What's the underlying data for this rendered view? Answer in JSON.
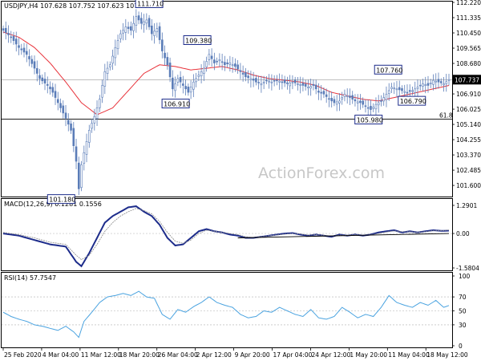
{
  "chart_data": [
    {
      "panel": "price",
      "type": "candlestick",
      "header": "USDJPY,H4  107.628 107.752 107.623 107.737",
      "ylim": [
        101.0,
        112.22
      ],
      "y_ticks": [
        "112.220",
        "111.335",
        "110.450",
        "109.565",
        "108.680",
        "107.795",
        "106.910",
        "106.025",
        "105.140",
        "104.255",
        "103.370",
        "102.485",
        "101.600"
      ],
      "current_price": "107.737",
      "level_61_8": {
        "label": "61.8",
        "value": 105.45
      },
      "horizontal_line": 107.737,
      "annotations": [
        {
          "text": "111.710",
          "x": "Mar 20",
          "value": 111.71
        },
        {
          "text": "109.380",
          "x": "Mar 30",
          "value": 109.38
        },
        {
          "text": "106.910",
          "x": "Mar 26",
          "value": 106.91
        },
        {
          "text": "107.760",
          "x": "May 5",
          "value": 107.76
        },
        {
          "text": "106.790",
          "x": "May 7",
          "value": 106.79
        },
        {
          "text": "105.980",
          "x": "May 6",
          "value": 105.98
        },
        {
          "text": "101.180",
          "x": "Mar 9",
          "value": 101.18
        }
      ],
      "close_series": [
        [
          0,
          110.6
        ],
        [
          3,
          110.2
        ],
        [
          6,
          109.6
        ],
        [
          9,
          109.2
        ],
        [
          12,
          108.4
        ],
        [
          14,
          107.8
        ],
        [
          17,
          107.4
        ],
        [
          19,
          107.0
        ],
        [
          21,
          106.4
        ],
        [
          24,
          105.5
        ],
        [
          26,
          104.8
        ],
        [
          28,
          103.0
        ],
        [
          29,
          101.4
        ],
        [
          30,
          102.8
        ],
        [
          31,
          103.5
        ],
        [
          33,
          104.8
        ],
        [
          35,
          105.6
        ],
        [
          37,
          106.6
        ],
        [
          39,
          108.2
        ],
        [
          41,
          108.6
        ],
        [
          43,
          109.6
        ],
        [
          45,
          110.4
        ],
        [
          47,
          110.8
        ],
        [
          49,
          110.6
        ],
        [
          51,
          111.4
        ],
        [
          53,
          111.0
        ],
        [
          55,
          111.2
        ],
        [
          57,
          110.4
        ],
        [
          59,
          110.7
        ],
        [
          61,
          109.4
        ],
        [
          63,
          108.6
        ],
        [
          65,
          107.2
        ],
        [
          67,
          107.8
        ],
        [
          69,
          107.4
        ],
        [
          71,
          107.0
        ],
        [
          73,
          107.6
        ],
        [
          75,
          108.0
        ],
        [
          77,
          108.4
        ],
        [
          79,
          109.2
        ],
        [
          81,
          108.7
        ],
        [
          83,
          108.9
        ],
        [
          85,
          108.6
        ],
        [
          87,
          108.7
        ],
        [
          89,
          108.5
        ],
        [
          91,
          108.2
        ],
        [
          93,
          107.9
        ],
        [
          95,
          107.8
        ],
        [
          97,
          107.6
        ],
        [
          99,
          107.5
        ],
        [
          101,
          107.7
        ],
        [
          103,
          107.6
        ],
        [
          105,
          107.7
        ],
        [
          107,
          107.6
        ],
        [
          109,
          107.5
        ],
        [
          111,
          107.6
        ],
        [
          113,
          107.5
        ],
        [
          115,
          107.4
        ],
        [
          117,
          107.3
        ],
        [
          119,
          107.4
        ],
        [
          121,
          107.0
        ],
        [
          123,
          106.9
        ],
        [
          125,
          106.6
        ],
        [
          127,
          106.4
        ],
        [
          129,
          106.5
        ],
        [
          131,
          106.9
        ],
        [
          133,
          106.7
        ],
        [
          135,
          106.5
        ],
        [
          137,
          106.4
        ],
        [
          139,
          106.2
        ],
        [
          141,
          106.0
        ],
        [
          143,
          106.3
        ],
        [
          145,
          106.5
        ],
        [
          147,
          106.9
        ],
        [
          149,
          107.3
        ],
        [
          151,
          107.2
        ],
        [
          153,
          107.1
        ],
        [
          155,
          107.0
        ],
        [
          157,
          107.1
        ],
        [
          159,
          107.3
        ],
        [
          161,
          107.5
        ],
        [
          163,
          107.4
        ],
        [
          165,
          107.7
        ],
        [
          167,
          107.6
        ],
        [
          169,
          107.5
        ],
        [
          171,
          107.74
        ]
      ],
      "ma_series": [
        [
          0,
          110.5
        ],
        [
          6,
          110.2
        ],
        [
          12,
          109.6
        ],
        [
          18,
          108.7
        ],
        [
          24,
          107.6
        ],
        [
          30,
          106.4
        ],
        [
          36,
          105.7
        ],
        [
          42,
          106.1
        ],
        [
          48,
          107.1
        ],
        [
          54,
          108.1
        ],
        [
          60,
          108.6
        ],
        [
          66,
          108.5
        ],
        [
          72,
          108.3
        ],
        [
          78,
          108.4
        ],
        [
          84,
          108.5
        ],
        [
          90,
          108.3
        ],
        [
          96,
          108.0
        ],
        [
          102,
          107.8
        ],
        [
          108,
          107.7
        ],
        [
          114,
          107.6
        ],
        [
          120,
          107.4
        ],
        [
          126,
          107.0
        ],
        [
          132,
          106.8
        ],
        [
          138,
          106.6
        ],
        [
          144,
          106.5
        ],
        [
          150,
          106.7
        ],
        [
          156,
          106.9
        ],
        [
          162,
          107.1
        ],
        [
          168,
          107.3
        ],
        [
          171,
          107.4
        ]
      ]
    },
    {
      "panel": "macd",
      "type": "line",
      "header": "MACD(12,26,9) 0.1281 0.1556",
      "ylim": [
        -1.5804,
        1.2901
      ],
      "y_ticks": [
        "1.2901",
        "0.00",
        "-1.5804"
      ],
      "series": [
        {
          "name": "MACD",
          "values": [
            [
              0,
              0.0
            ],
            [
              6,
              -0.1
            ],
            [
              12,
              -0.3
            ],
            [
              18,
              -0.5
            ],
            [
              24,
              -0.6
            ],
            [
              28,
              -1.3
            ],
            [
              30,
              -1.5
            ],
            [
              33,
              -0.9
            ],
            [
              36,
              -0.2
            ],
            [
              39,
              0.5
            ],
            [
              42,
              0.8
            ],
            [
              45,
              1.0
            ],
            [
              48,
              1.2
            ],
            [
              51,
              1.25
            ],
            [
              54,
              1.0
            ],
            [
              57,
              0.8
            ],
            [
              60,
              0.4
            ],
            [
              63,
              -0.2
            ],
            [
              66,
              -0.55
            ],
            [
              69,
              -0.5
            ],
            [
              72,
              -0.2
            ],
            [
              75,
              0.1
            ],
            [
              78,
              0.2
            ],
            [
              81,
              0.1
            ],
            [
              84,
              0.05
            ],
            [
              87,
              -0.05
            ],
            [
              90,
              -0.1
            ],
            [
              93,
              -0.2
            ],
            [
              96,
              -0.2
            ],
            [
              99,
              -0.15
            ],
            [
              102,
              -0.1
            ],
            [
              105,
              -0.05
            ],
            [
              108,
              0.0
            ],
            [
              111,
              0.02
            ],
            [
              114,
              -0.05
            ],
            [
              117,
              -0.1
            ],
            [
              120,
              -0.05
            ],
            [
              123,
              -0.1
            ],
            [
              126,
              -0.15
            ],
            [
              129,
              -0.05
            ],
            [
              132,
              -0.1
            ],
            [
              135,
              -0.05
            ],
            [
              138,
              -0.1
            ],
            [
              141,
              -0.05
            ],
            [
              144,
              0.05
            ],
            [
              147,
              0.1
            ],
            [
              150,
              0.15
            ],
            [
              153,
              0.05
            ],
            [
              156,
              0.1
            ],
            [
              159,
              0.05
            ],
            [
              162,
              0.1
            ],
            [
              165,
              0.15
            ],
            [
              168,
              0.12
            ],
            [
              171,
              0.13
            ]
          ]
        },
        {
          "name": "Signal",
          "values": [
            [
              0,
              0.05
            ],
            [
              6,
              -0.05
            ],
            [
              12,
              -0.2
            ],
            [
              18,
              -0.4
            ],
            [
              24,
              -0.5
            ],
            [
              28,
              -1.0
            ],
            [
              30,
              -1.2
            ],
            [
              33,
              -1.0
            ],
            [
              36,
              -0.5
            ],
            [
              39,
              0.1
            ],
            [
              42,
              0.5
            ],
            [
              45,
              0.8
            ],
            [
              48,
              1.0
            ],
            [
              51,
              1.15
            ],
            [
              54,
              1.05
            ],
            [
              57,
              0.9
            ],
            [
              60,
              0.55
            ],
            [
              63,
              0.05
            ],
            [
              66,
              -0.35
            ],
            [
              69,
              -0.45
            ],
            [
              72,
              -0.3
            ],
            [
              75,
              0.0
            ],
            [
              78,
              0.15
            ],
            [
              81,
              0.1
            ],
            [
              84,
              0.05
            ],
            [
              87,
              0.0
            ],
            [
              90,
              -0.05
            ],
            [
              93,
              -0.15
            ],
            [
              96,
              -0.18
            ],
            [
              99,
              -0.15
            ],
            [
              102,
              -0.1
            ],
            [
              105,
              -0.07
            ],
            [
              108,
              -0.03
            ],
            [
              111,
              0.0
            ],
            [
              114,
              -0.02
            ],
            [
              117,
              -0.07
            ],
            [
              120,
              -0.06
            ],
            [
              123,
              -0.08
            ],
            [
              126,
              -0.12
            ],
            [
              129,
              -0.08
            ],
            [
              132,
              -0.08
            ],
            [
              135,
              -0.06
            ],
            [
              138,
              -0.08
            ],
            [
              141,
              -0.06
            ],
            [
              144,
              0.0
            ],
            [
              147,
              0.07
            ],
            [
              150,
              0.12
            ],
            [
              153,
              0.08
            ],
            [
              156,
              0.08
            ],
            [
              159,
              0.06
            ],
            [
              162,
              0.08
            ],
            [
              165,
              0.13
            ],
            [
              168,
              0.13
            ],
            [
              171,
              0.16
            ]
          ]
        },
        {
          "name": "Trendline",
          "values": [
            [
              90,
              -0.2
            ],
            [
              171,
              0.0
            ]
          ]
        }
      ]
    },
    {
      "panel": "rsi",
      "type": "line",
      "header": "RSI(14) 57.7547",
      "ylim": [
        0,
        100
      ],
      "y_ticks": [
        "100",
        "70",
        "50",
        "30",
        "0"
      ],
      "series": [
        {
          "name": "RSI",
          "values": [
            [
              0,
              48
            ],
            [
              3,
              42
            ],
            [
              6,
              38
            ],
            [
              9,
              35
            ],
            [
              12,
              30
            ],
            [
              15,
              28
            ],
            [
              18,
              25
            ],
            [
              21,
              22
            ],
            [
              24,
              28
            ],
            [
              27,
              20
            ],
            [
              29,
              12
            ],
            [
              31,
              35
            ],
            [
              34,
              48
            ],
            [
              37,
              62
            ],
            [
              40,
              70
            ],
            [
              43,
              72
            ],
            [
              46,
              75
            ],
            [
              49,
              72
            ],
            [
              52,
              78
            ],
            [
              55,
              70
            ],
            [
              58,
              68
            ],
            [
              61,
              45
            ],
            [
              64,
              38
            ],
            [
              67,
              52
            ],
            [
              70,
              48
            ],
            [
              73,
              56
            ],
            [
              76,
              62
            ],
            [
              79,
              70
            ],
            [
              82,
              62
            ],
            [
              85,
              58
            ],
            [
              88,
              55
            ],
            [
              91,
              45
            ],
            [
              94,
              40
            ],
            [
              97,
              42
            ],
            [
              100,
              50
            ],
            [
              103,
              48
            ],
            [
              106,
              55
            ],
            [
              109,
              50
            ],
            [
              112,
              45
            ],
            [
              115,
              42
            ],
            [
              118,
              52
            ],
            [
              121,
              40
            ],
            [
              124,
              38
            ],
            [
              127,
              42
            ],
            [
              130,
              55
            ],
            [
              133,
              48
            ],
            [
              136,
              40
            ],
            [
              139,
              45
            ],
            [
              142,
              42
            ],
            [
              145,
              55
            ],
            [
              148,
              72
            ],
            [
              151,
              62
            ],
            [
              154,
              58
            ],
            [
              157,
              55
            ],
            [
              160,
              62
            ],
            [
              163,
              58
            ],
            [
              166,
              65
            ],
            [
              169,
              55
            ],
            [
              171,
              57.75
            ]
          ]
        }
      ]
    }
  ],
  "x_axis_labels": [
    "25 Feb 2020",
    "4 Mar 04:00",
    "11 Mar 12:00",
    "18 Mar 20:00",
    "26 Mar 04:00",
    "2 Apr 12:00",
    "9 Apr 20:00",
    "17 Apr 04:00",
    "24 Apr 12:00",
    "1 May 20:00",
    "11 May 04:00",
    "18 May 12:00"
  ],
  "watermark": "ActionForex.com",
  "colors": {
    "candle": "#5b7db8",
    "ma": "#e8323a",
    "macd": "#1d2c8b",
    "signal": "#8a8a8a",
    "rsi": "#4aa3e0",
    "label_border": "#1d2c8b",
    "price_tag_bg": "#000000",
    "price_tag_text": "#ffffff"
  }
}
